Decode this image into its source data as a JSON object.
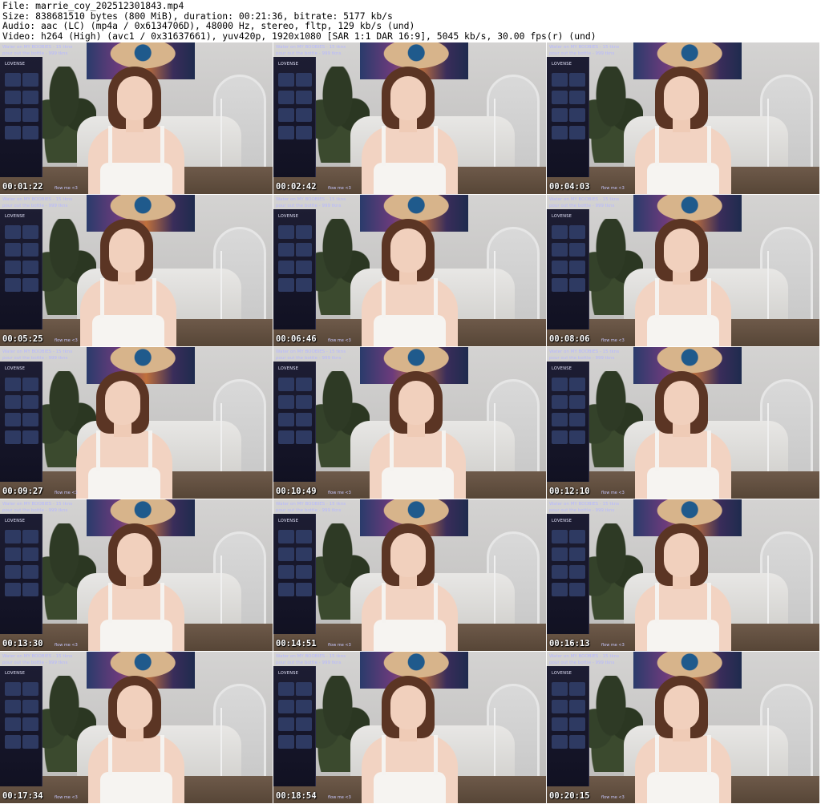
{
  "header": {
    "line1": "File: marrie_coy_202512301843.mp4",
    "line2": "Size: 838681510 bytes (800 MiB), duration: 00:21:36, bitrate: 5177 kb/s",
    "line3": "Audio: aac (LC) (mp4a / 0x6134706D), 48000 Hz, stereo, fltp, 129 kb/s (und)",
    "line4": "Video: h264 (High) (avc1 / 0x31637661), yuv420p, 1920x1080 [SAR 1:1 DAR 16:9], 5045 kb/s, 30.00 fps(r) (und)"
  },
  "overlay": {
    "top_line1": "Water on MY BOOBIES - 15 tkns",
    "top_line2": "pour out the bottle - 999 tkns",
    "brand": "LOVENSE",
    "tag": "flow me <3"
  },
  "frames": [
    {
      "timestamp": "00:01:22"
    },
    {
      "timestamp": "00:02:42"
    },
    {
      "timestamp": "00:04:03"
    },
    {
      "timestamp": "00:05:25"
    },
    {
      "timestamp": "00:06:46"
    },
    {
      "timestamp": "00:08:06"
    },
    {
      "timestamp": "00:09:27"
    },
    {
      "timestamp": "00:10:49"
    },
    {
      "timestamp": "00:12:10"
    },
    {
      "timestamp": "00:13:30"
    },
    {
      "timestamp": "00:14:51"
    },
    {
      "timestamp": "00:16:13"
    },
    {
      "timestamp": "00:17:34"
    },
    {
      "timestamp": "00:18:54"
    },
    {
      "timestamp": "00:20:15"
    }
  ],
  "colors": {
    "timestamp_text": "#ffffff",
    "overlay_text": "#b6b8ff",
    "hair": "#5b3524",
    "top": "#f6f4f1"
  }
}
